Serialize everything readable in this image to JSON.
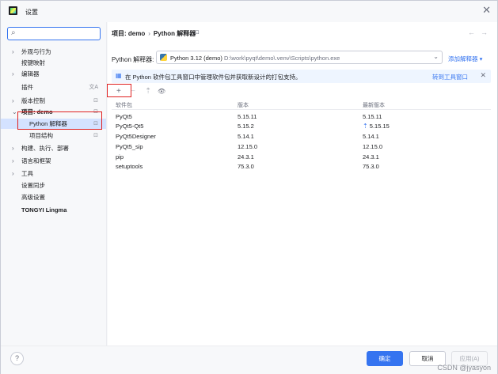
{
  "window": {
    "title": "设置",
    "close_glyph": "✕"
  },
  "sidebar": {
    "search": {
      "value": "",
      "placeholder": ""
    },
    "items": [
      {
        "label": "外观与行为",
        "expandable": true
      },
      {
        "label": "按键映射",
        "expandable": false
      },
      {
        "label": "编辑器",
        "expandable": true
      },
      {
        "label": "插件",
        "expandable": false,
        "badge": "文A"
      },
      {
        "label": "版本控制",
        "expandable": true,
        "badge": "⊡"
      },
      {
        "label": "项目: demo",
        "expandable": true,
        "expanded": true,
        "badge": "⊡"
      },
      {
        "label": "Python 解释器",
        "sub": true,
        "selected": true,
        "badge": "⊡"
      },
      {
        "label": "项目结构",
        "sub": true,
        "badge": "⊡"
      },
      {
        "label": "构建、执行、部署",
        "expandable": true
      },
      {
        "label": "语言和框架",
        "expandable": true
      },
      {
        "label": "工具",
        "expandable": true
      },
      {
        "label": "设置同步",
        "expandable": false
      },
      {
        "label": "高级设置",
        "expandable": false
      },
      {
        "label": "TONGYI Lingma",
        "expandable": false
      }
    ]
  },
  "main": {
    "breadcrumb": {
      "project": "项目: demo",
      "separator": "›",
      "page": "Python 解释器"
    },
    "interpreter": {
      "label": "Python 解释器:",
      "name": "Python 3.12 (demo)",
      "path": "D:\\work\\pyqt\\demo\\.venv\\Scripts\\python.exe",
      "add_link": "添加解释器 ▾"
    },
    "banner": {
      "text": "在 Python 软件包工具窗口中管理软件包并获取新设计的打包支持。",
      "link": "转到工具窗口",
      "close": "✕"
    },
    "toolbar": {
      "add": "+",
      "remove": "−",
      "upgrade": "⇡",
      "show": "👁"
    },
    "table": {
      "headers": [
        "软件包",
        "版本",
        "最新版本"
      ],
      "rows": [
        {
          "package": "PyQt5",
          "version": "5.15.11",
          "latest": "5.15.11",
          "upgrade": false
        },
        {
          "package": "PyQt5-Qt5",
          "version": "5.15.2",
          "latest": "5.15.15",
          "upgrade": true
        },
        {
          "package": "PyQt5Designer",
          "version": "5.14.1",
          "latest": "5.14.1",
          "upgrade": false
        },
        {
          "package": "PyQt5_sip",
          "version": "12.15.0",
          "latest": "12.15.0",
          "upgrade": false
        },
        {
          "package": "pip",
          "version": "24.3.1",
          "latest": "24.3.1",
          "upgrade": false
        },
        {
          "package": "setuptools",
          "version": "75.3.0",
          "latest": "75.3.0",
          "upgrade": false
        }
      ]
    }
  },
  "footer": {
    "help": "?",
    "ok": "确定",
    "cancel": "取消",
    "apply": "应用(A)",
    "watermark": "CSDN @jyasyon"
  },
  "colors": {
    "accent": "#3574f0",
    "selection": "#d4e2ff",
    "highlight": "#e02020"
  }
}
